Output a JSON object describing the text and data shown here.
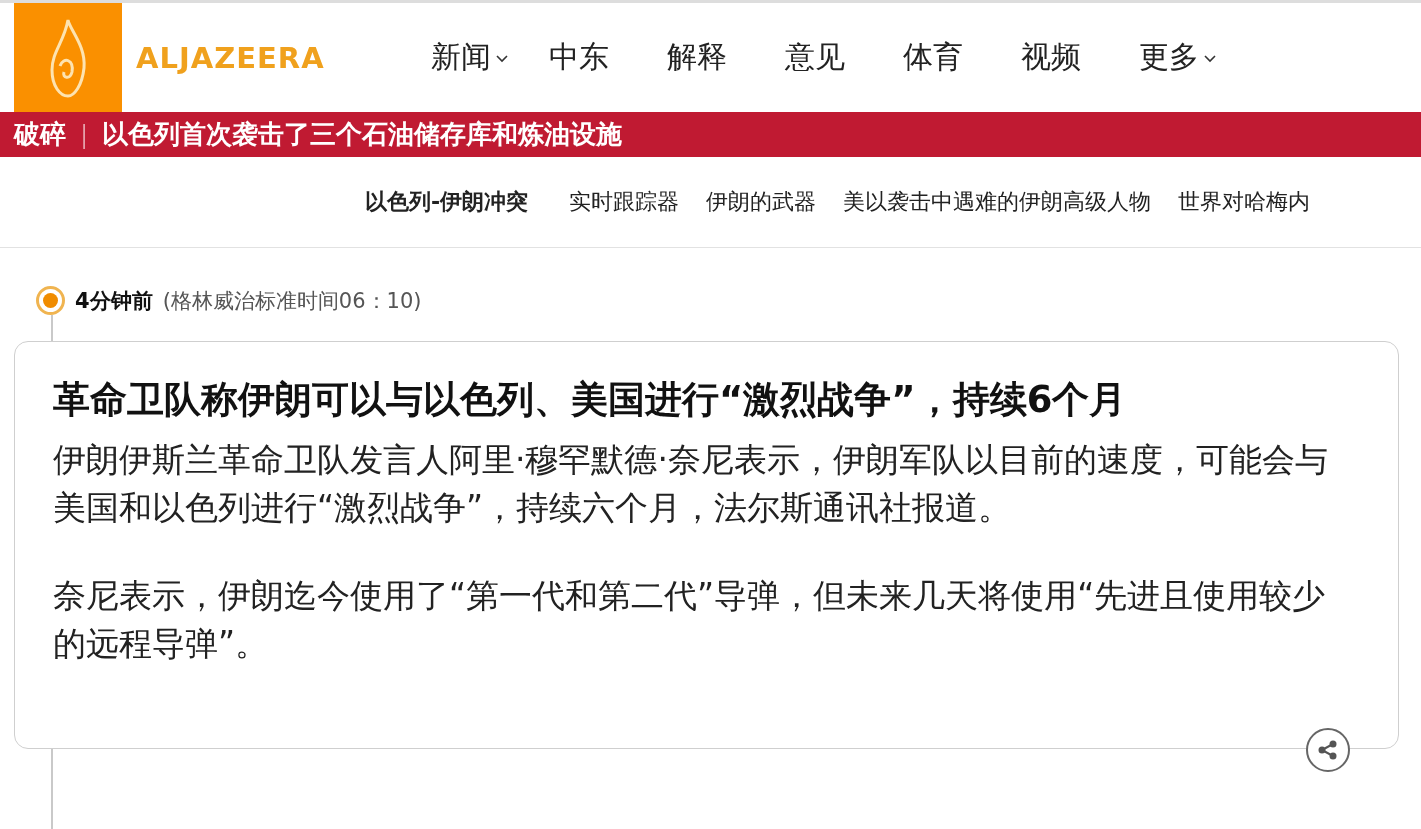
{
  "logo": {
    "wordmark": "ALJAZEERA"
  },
  "nav": [
    {
      "label": "新闻",
      "dropdown": true
    },
    {
      "label": "中东",
      "dropdown": false
    },
    {
      "label": "解释",
      "dropdown": false
    },
    {
      "label": "意见",
      "dropdown": false
    },
    {
      "label": "体育",
      "dropdown": false
    },
    {
      "label": "视频",
      "dropdown": false
    },
    {
      "label": "更多",
      "dropdown": true
    }
  ],
  "breaking": {
    "label": "破碎",
    "separator": "|",
    "headline": "以色列首次袭击了三个石油储存库和炼油设施"
  },
  "topics": [
    {
      "label": "以色列-伊朗冲突",
      "selected": true
    },
    {
      "label": "实时跟踪器",
      "selected": false
    },
    {
      "label": "伊朗的武器",
      "selected": false
    },
    {
      "label": "美以袭击中遇难的伊朗高级人物",
      "selected": false
    },
    {
      "label": "世界对哈梅内",
      "selected": false
    }
  ],
  "live_update": {
    "time_ago": "4分钟前",
    "timestamp": "(格林威治标准时间06：10)",
    "title": "革命卫队称伊朗可以与以色列、美国进行“激烈战争”，持续6个月",
    "paragraphs": [
      "伊朗伊斯兰革命卫队发言人阿里·穆罕默德·奈尼表示，伊朗军队以目前的速度，可能会与美国和以色列进行“激烈战争”，持续六个月，法尔斯通讯社报道。",
      "奈尼表示，伊朗迄今使用了“第一代和第二代”导弹，但未来几天将使用“先进且使用较少的远程导弹”。"
    ]
  }
}
